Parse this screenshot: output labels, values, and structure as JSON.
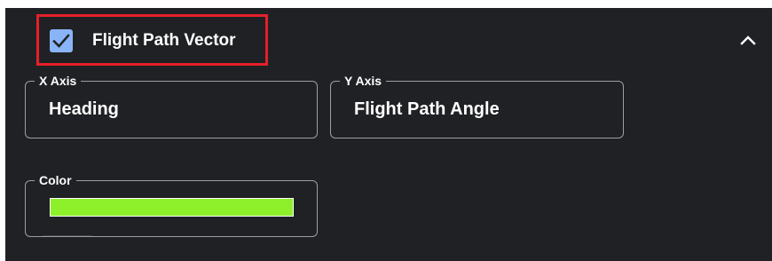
{
  "section": {
    "title": "Flight Path Vector",
    "checked": true,
    "checkbox_icon": "checkmark-icon",
    "collapse_icon": "chevron-up-icon"
  },
  "fields": {
    "x_axis": {
      "label": "X Axis",
      "value": "Heading"
    },
    "y_axis": {
      "label": "Y Axis",
      "value": "Flight Path Angle"
    },
    "color": {
      "label": "Color",
      "value": "#8ef02a"
    }
  },
  "colors": {
    "panel_background": "#202124",
    "checkbox": "#8ab4f8",
    "highlight_border": "#e5202a",
    "field_border": "#9aa0a6",
    "text": "#ffffff"
  }
}
